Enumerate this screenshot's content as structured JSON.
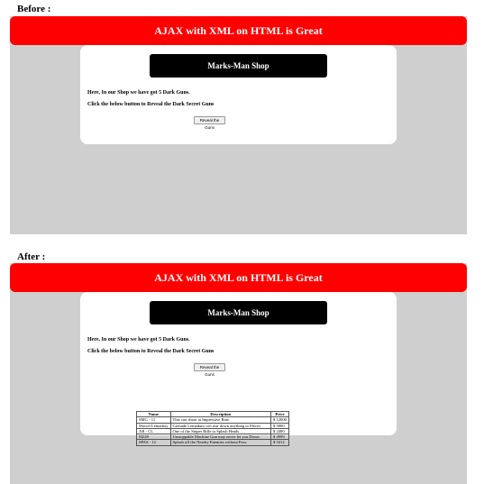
{
  "before": {
    "label": "Before :",
    "banner": "AJAX with XML on HTML is Great",
    "shop_title": "Marks-Man Shop",
    "line1": "Here, In our Shop we have got 5 Dark Guns.",
    "line2": "Click the below button to Reveal the Dark Secret Guns",
    "button": "Reveal the Guns"
  },
  "after": {
    "label": "After :",
    "banner": "AJAX with XML on HTML is Great",
    "shop_title": "Marks-Man Shop",
    "line1": "Here, In our Shop we have got 5 Dark Guns.",
    "line2": "Click the below button to Reveal the Dark Secret Guns",
    "button": "Reveal the Guns",
    "table": {
      "headers": [
        "Name",
        "Description",
        "Price"
      ],
      "rows": [
        [
          "SMG - 11",
          "This con shoot at Impressive Rate.",
          "$ 12000"
        ],
        [
          "Shovel Lemadary",
          "Grenade Lemadaru con tear down anything to Pieces.",
          "$ 5000"
        ],
        [
          "AR - CL",
          "One of the Sniper Rifle to Splash Heads.",
          "$ 2400"
        ],
        [
          "M249",
          "Unstoppable Machine Gun may never let you Down.",
          "$ 4999"
        ],
        [
          "SPAS - 12",
          "Splash off the Nearby Enemies without Fear.",
          "$ 5412"
        ]
      ]
    }
  }
}
